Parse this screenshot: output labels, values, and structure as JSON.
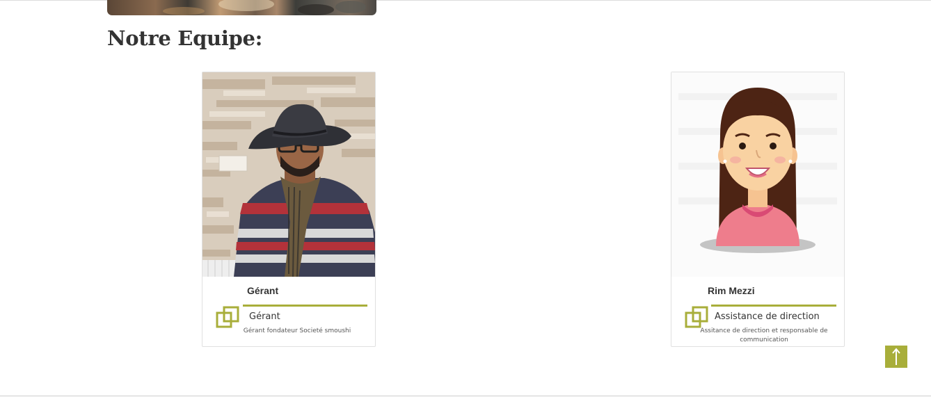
{
  "section": {
    "title": "Notre Equipe:"
  },
  "members": [
    {
      "name": "Gérant",
      "role": "Gérant",
      "description": "Gérant fondateur Societé smoushi",
      "photo_alt": "photo of man in hat and striped sweater"
    },
    {
      "name": "Rim Mezzi",
      "role": "Assistance de direction",
      "description": "Assitance de direction et responsable de communication",
      "photo_alt": "cartoon avatar of woman with long brown hair"
    }
  ],
  "colors": {
    "accent": "#a8ae3a",
    "title": "#333333",
    "card_border": "#e0e0e0"
  },
  "icons": {
    "role": "copy-squares-icon",
    "back_to_top": "arrow-up-icon"
  }
}
